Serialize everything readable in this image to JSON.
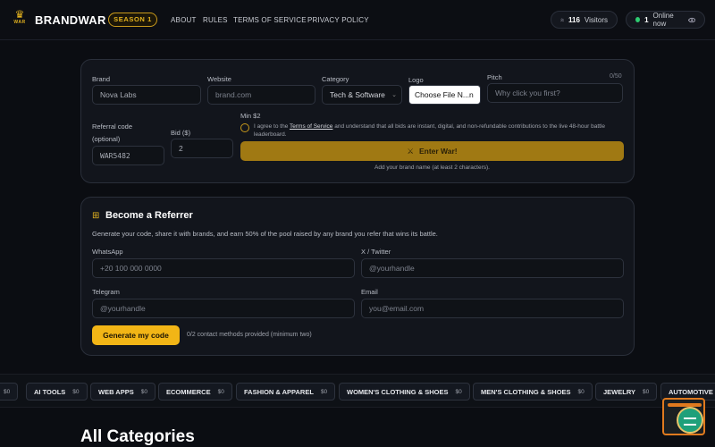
{
  "header": {
    "logo_word": "WAR",
    "brand": "BRANDWAR",
    "season": "SEASON 1",
    "nav": [
      "ABOUT",
      "RULES",
      "TERMS OF SERVICE",
      "PRIVACY POLICY"
    ],
    "visitors_count": "116",
    "visitors_label": "Visitors",
    "online_count": "1",
    "online_label": "Online now"
  },
  "entry_form": {
    "brand_label": "Brand",
    "brand_value": "Nova Labs",
    "website_label": "Website",
    "website_placeholder": "brand.com",
    "category_label": "Category",
    "category_value": "Tech & Software",
    "logo_label": "Logo",
    "logo_button": "Choose File  N...n",
    "pitch_label": "Pitch",
    "pitch_counter": "0/50",
    "pitch_placeholder": "Why click you first?",
    "referral_label": "Referral code",
    "referral_optional": "(optional)",
    "referral_value": "WAR5482",
    "bid_label": "Bid ($)",
    "bid_value": "2",
    "min_label": "Min $2",
    "agree_prefix": "I agree to the ",
    "agree_link": "Terms of Service",
    "agree_suffix": " and understand that all bids are instant, digital, and non-refundable contributions to the live 48-hour battle leaderboard.",
    "enter_button": "Enter War!",
    "hint": "Add your brand name (at least 2 characters)."
  },
  "referrer": {
    "title": "Become a Referrer",
    "description": "Generate your code, share it with brands, and earn 50% of the pool raised by any brand you refer that wins its battle.",
    "whatsapp_label": "WhatsApp",
    "whatsapp_placeholder": "+20 100 000 0000",
    "twitter_label": "X / Twitter",
    "twitter_placeholder": "@yourhandle",
    "telegram_label": "Telegram",
    "telegram_placeholder": "@yourhandle",
    "email_label": "Email",
    "email_placeholder": "you@email.com",
    "generate_button": "Generate my code",
    "methods_status": "0/2 contact methods provided (minimum two)"
  },
  "categories_strip": {
    "leading_amount": "$0",
    "items": [
      {
        "name": "AI TOOLS",
        "amount": "$0"
      },
      {
        "name": "WEB APPS",
        "amount": "$0"
      },
      {
        "name": "ECOMMERCE",
        "amount": "$0"
      },
      {
        "name": "FASHION & APPAREL",
        "amount": "$0"
      },
      {
        "name": "WOMEN'S CLOTHING & SHOES",
        "amount": "$0"
      },
      {
        "name": "MEN'S CLOTHING & SHOES",
        "amount": "$0"
      },
      {
        "name": "JEWELRY",
        "amount": "$0"
      },
      {
        "name": "AUTOMOTIVE",
        "amount": ""
      }
    ]
  },
  "all_categories_title": "All Categories",
  "colors": {
    "accent": "#e3b21f",
    "button": "#f2b516",
    "online": "#2ecc71"
  },
  "icons": {
    "logo": "crown-icon",
    "visitors": "users-icon",
    "online": "eye-icon",
    "enter": "swords-icon",
    "referrer": "gift-icon"
  }
}
